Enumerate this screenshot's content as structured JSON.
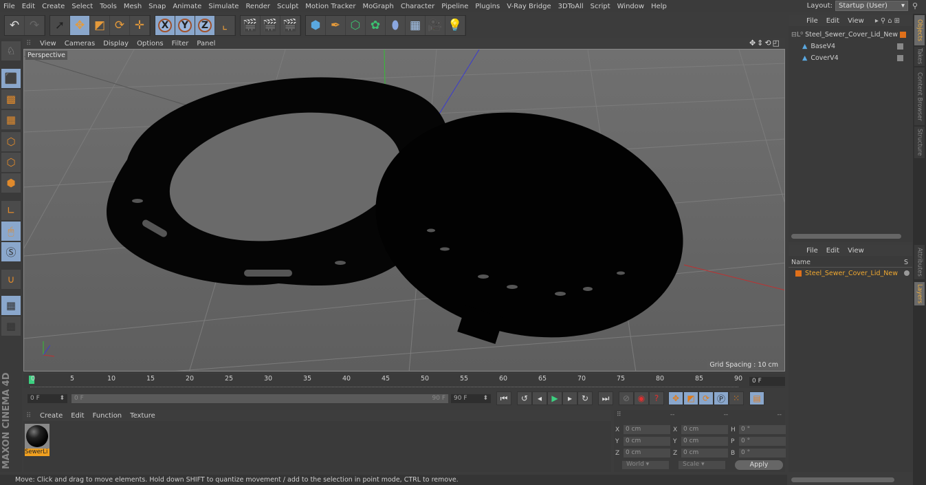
{
  "menubar": {
    "items": [
      "File",
      "Edit",
      "Create",
      "Select",
      "Tools",
      "Mesh",
      "Snap",
      "Animate",
      "Simulate",
      "Render",
      "Sculpt",
      "Motion Tracker",
      "MoGraph",
      "Character",
      "Pipeline",
      "Plugins",
      "V-Ray Bridge",
      "3DToAll",
      "Script",
      "Window",
      "Help"
    ],
    "layout_label": "Layout:",
    "layout_value": "Startup (User)"
  },
  "toolbar": {
    "icons": [
      "undo-icon",
      "redo-icon",
      "live-selection-icon",
      "move-icon",
      "scale-icon",
      "rotate-icon",
      "add-icon",
      "x-axis-icon",
      "y-axis-icon",
      "z-axis-icon",
      "coordinate-system-icon",
      "render-view-icon",
      "render-to-picture-viewer-icon",
      "render-settings-icon",
      "cube-icon",
      "pen-icon",
      "subdivision-icon",
      "cloner-icon",
      "deformer-icon",
      "floor-icon",
      "camera-icon",
      "light-icon"
    ]
  },
  "viewport": {
    "menu": [
      "View",
      "Cameras",
      "Display",
      "Options",
      "Filter",
      "Panel"
    ],
    "camera_label": "Perspective",
    "grid_spacing": "Grid Spacing : 10 cm"
  },
  "timeline": {
    "ticks": [
      "0",
      "5",
      "10",
      "15",
      "20",
      "25",
      "30",
      "35",
      "40",
      "45",
      "50",
      "55",
      "60",
      "65",
      "70",
      "75",
      "80",
      "85",
      "90"
    ],
    "current_frame": "0 F",
    "start_field": "0 F",
    "range_start": "0 F",
    "range_end": "90 F",
    "end_field": "90 F"
  },
  "material_manager": {
    "menu": [
      "Create",
      "Edit",
      "Function",
      "Texture"
    ],
    "materials": [
      {
        "name": "SewerLi"
      }
    ]
  },
  "brand": "MAXON CINEMA 4D",
  "coordinates": {
    "headers": [
      "--",
      "--",
      "--"
    ],
    "position": [
      {
        "axis": "X",
        "value": "0 cm"
      },
      {
        "axis": "Y",
        "value": "0 cm"
      },
      {
        "axis": "Z",
        "value": "0 cm"
      }
    ],
    "size": [
      {
        "axis": "X",
        "value": "0 cm"
      },
      {
        "axis": "Y",
        "value": "0 cm"
      },
      {
        "axis": "Z",
        "value": "0 cm"
      }
    ],
    "rotation": [
      {
        "axis": "H",
        "value": "0 °"
      },
      {
        "axis": "P",
        "value": "0 °"
      },
      {
        "axis": "B",
        "value": "0 °"
      }
    ],
    "world_select": "World",
    "scale_select": "Scale",
    "apply_label": "Apply"
  },
  "status": "Move: Click and drag to move elements. Hold down SHIFT to quantize movement / add to the selection in point mode, CTRL to remove.",
  "object_manager": {
    "menu": [
      "File",
      "Edit",
      "View"
    ],
    "objects": [
      {
        "name": "Steel_Sewer_Cover_Lid_New",
        "level": 0
      },
      {
        "name": "BaseV4",
        "level": 1
      },
      {
        "name": "CoverV4",
        "level": 1
      }
    ]
  },
  "layer_manager": {
    "menu": [
      "File",
      "Edit",
      "View"
    ],
    "col_name": "Name",
    "col_s": "S",
    "layers": [
      {
        "name": "Steel_Sewer_Cover_Lid_New"
      }
    ]
  },
  "right_tabs": [
    "Objects",
    "Takes",
    "Content Browser",
    "Structure",
    "Attributes",
    "Layers"
  ],
  "colors": {
    "accent": "#8aa7cc",
    "layer_orange": "#e0701a",
    "layer_text": "#f0a830"
  }
}
